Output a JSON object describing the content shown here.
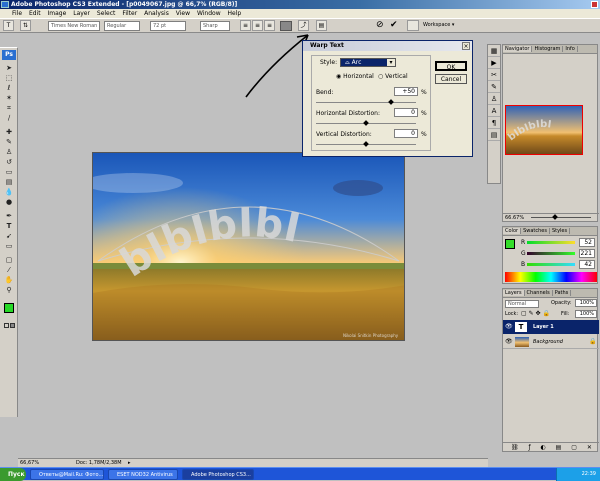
{
  "app": {
    "title": "Adobe Photoshop CS3 Extended - [p0049067.jpg @ 66,7% (RGB/8)]",
    "logo": "Ps"
  },
  "menu": [
    "File",
    "Edit",
    "Image",
    "Layer",
    "Select",
    "Filter",
    "Analysis",
    "View",
    "Window",
    "Help"
  ],
  "options": {
    "font_family": "Times New Roman",
    "font_style": "Regular",
    "font_size": "72 pt",
    "antialias": "Sharp",
    "workspace": "Workspace"
  },
  "warp_dialog": {
    "title": "Warp Text",
    "style_label": "Style:",
    "style_value": "Arc",
    "horizontal_label": "Horizontal",
    "vertical_label": "Vertical",
    "orientation": "Horizontal",
    "bend_label": "Bend:",
    "bend_value": "+50",
    "bend_pct": 0.75,
    "hdist_label": "Horizontal Distortion:",
    "hdist_value": "0",
    "hdist_pct": 0.5,
    "vdist_label": "Vertical Distortion:",
    "vdist_value": "0",
    "vdist_pct": 0.5,
    "percent": "%",
    "ok": "OK",
    "cancel": "Cancel"
  },
  "canvas": {
    "warped_text": "bIbIbIbI",
    "watermark": "Nikolai Snitkin Photography"
  },
  "navigator": {
    "tabs": [
      "Navigator",
      "Histogram",
      "Info"
    ],
    "zoom": "66.67%",
    "thumb_text": "bIbIbIbI"
  },
  "color_panel": {
    "tabs": [
      "Color",
      "Swatches",
      "Styles"
    ],
    "r_label": "R",
    "r_value": "52",
    "g_label": "G",
    "g_value": "221",
    "b_label": "B",
    "b_value": "42",
    "fg_color": "#34dd2a"
  },
  "layers_panel": {
    "tabs": [
      "Layers",
      "Channels",
      "Paths"
    ],
    "blend_mode": "Normal",
    "opacity_label": "Opacity:",
    "opacity_value": "100%",
    "lock_label": "Lock:",
    "fill_label": "Fill:",
    "fill_value": "100%",
    "layers": [
      {
        "name": "Layer 1",
        "kind": "text",
        "thumb": "T",
        "selected": true
      },
      {
        "name": "Background",
        "kind": "image",
        "selected": false
      }
    ]
  },
  "status": {
    "zoom": "66,67%",
    "doc": "Doc: 1,78M/2,38M"
  },
  "taskbar": {
    "start": "Пуск",
    "tasks": [
      "Ответы@Mail.Ru: Фото...",
      "ESET NOD32 Antivirus",
      "Adobe Photoshop CS3..."
    ],
    "clock": "22:39"
  }
}
